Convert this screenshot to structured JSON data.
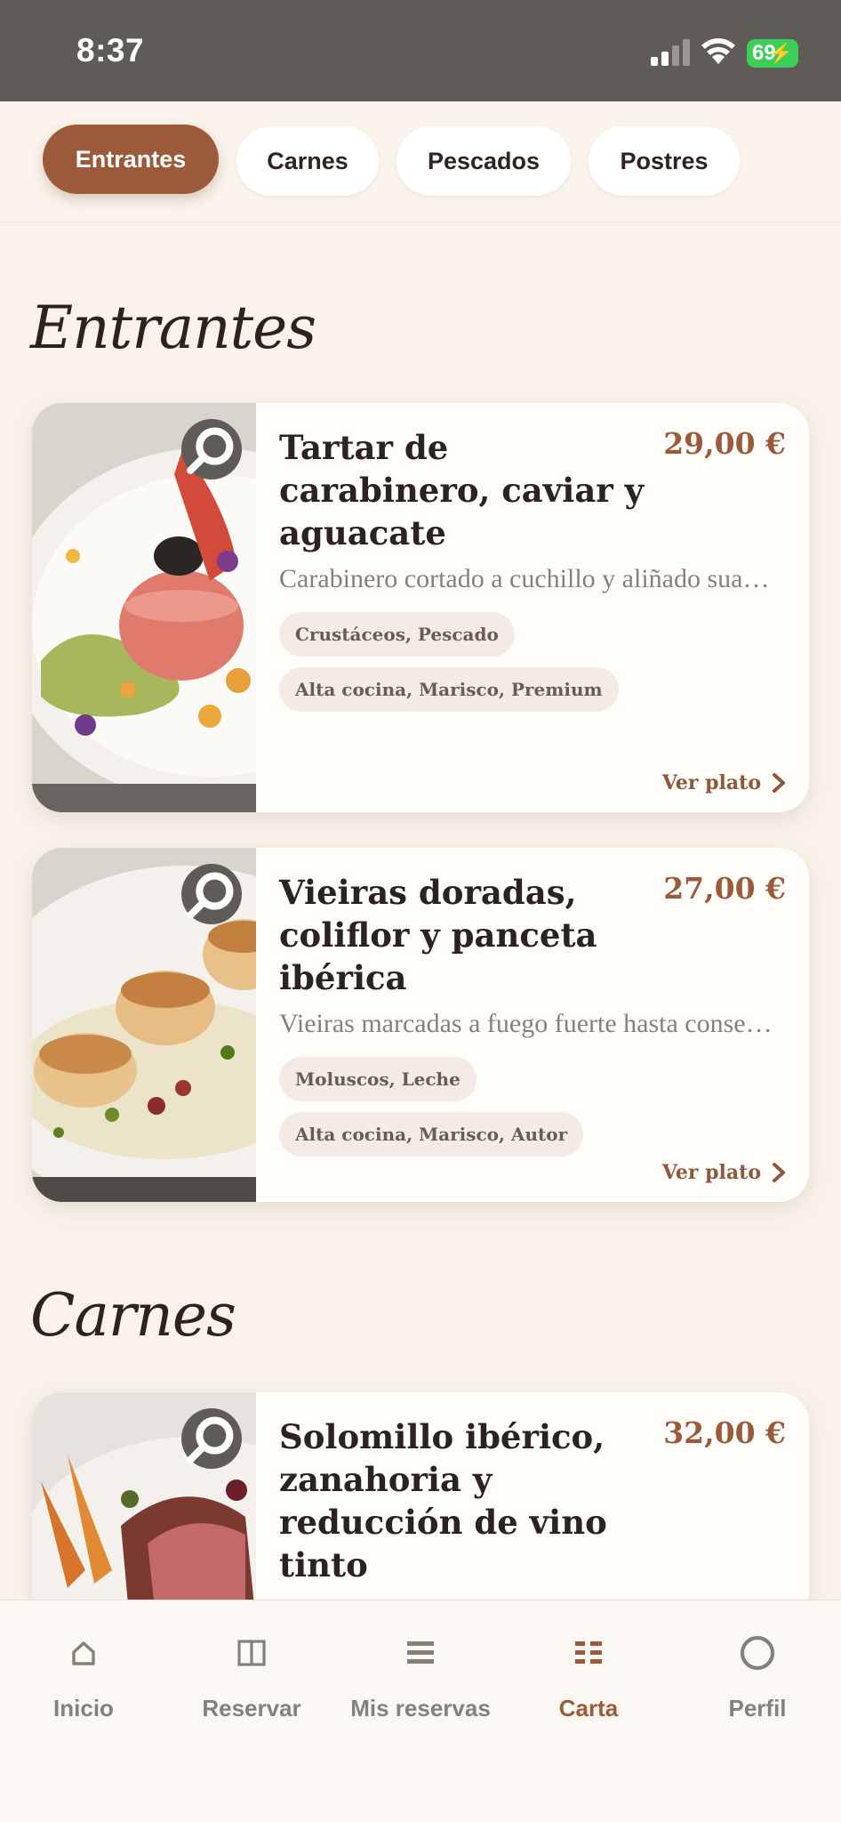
{
  "status": {
    "time": "8:37",
    "battery": "69"
  },
  "categories": [
    {
      "label": "Entrantes",
      "active": true
    },
    {
      "label": "Carnes",
      "active": false
    },
    {
      "label": "Pescados",
      "active": false
    },
    {
      "label": "Postres",
      "active": false
    }
  ],
  "sections": {
    "entrantes": {
      "title": "Entrantes",
      "dishes": [
        {
          "name": "Tartar de carabinero, caviar y aguacate",
          "price": "29,00 €",
          "description": "Carabinero cortado a cuchillo y aliñado suavemente con cítricos y aceite de oliv...",
          "tags": [
            "Crustáceos, Pescado",
            "Alta cocina, Marisco, Premium"
          ],
          "cta": "Ver plato"
        },
        {
          "name": "Vieiras doradas, coliflor y panceta ibérica",
          "price": "27,00 €",
          "description": "Vieiras marcadas a fuego fuerte hasta conseguir una superficie dorada y un...",
          "tags": [
            "Moluscos, Leche",
            "Alta cocina, Marisco, Autor"
          ],
          "cta": "Ver plato"
        }
      ]
    },
    "carnes": {
      "title": "Carnes",
      "dishes": [
        {
          "name": "Solomillo ibérico, zanahoria y reducción de vino tinto",
          "price": "32,00 €"
        }
      ]
    }
  },
  "tabbar": [
    {
      "label": "Inicio",
      "icon": "home-icon",
      "active": false
    },
    {
      "label": "Reservar",
      "icon": "book-icon",
      "active": false
    },
    {
      "label": "Mis reservas",
      "icon": "list-icon",
      "active": false
    },
    {
      "label": "Carta",
      "icon": "menu-grid-icon",
      "active": true
    },
    {
      "label": "Perfil",
      "icon": "profile-circle-icon",
      "active": false
    }
  ],
  "colors": {
    "accent": "#9c5a3a",
    "background": "#f8f2ea",
    "statusbar": "#5f5b57"
  }
}
